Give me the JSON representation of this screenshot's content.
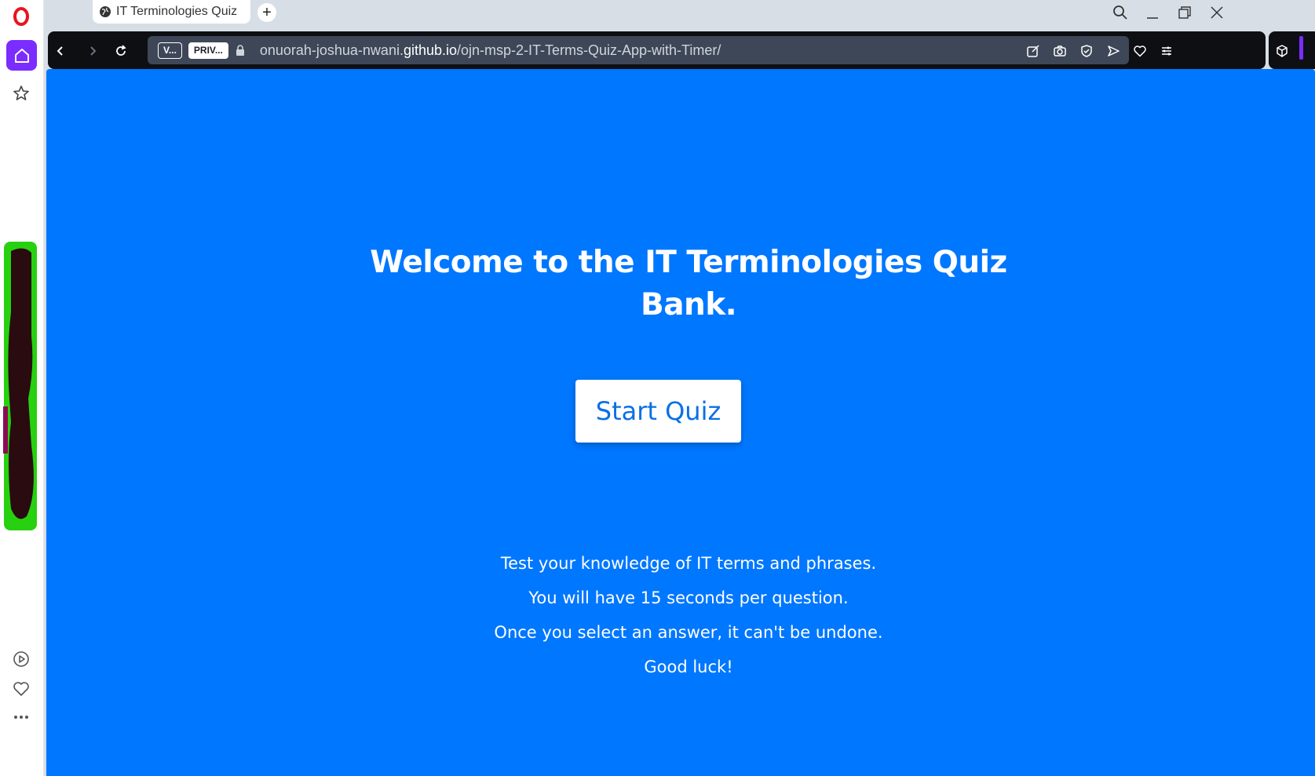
{
  "browser": {
    "tab_title": "IT Terminologies Quiz",
    "new_tab_symbol": "+",
    "address_chips": [
      "V...",
      "PRIV..."
    ],
    "url_prefix": "onuorah-joshua-nwani.",
    "url_domain": "github.io",
    "url_path": "/ojn-msp-2-IT-Terms-Quiz-App-with-Timer/"
  },
  "sidebar": {
    "icons": [
      "opera-logo-icon",
      "home-icon",
      "star-icon",
      "play-icon",
      "heart-icon",
      "more-icon"
    ]
  },
  "page": {
    "heading_line1": "Welcome to the IT Terminologies Quiz",
    "heading_line2": "Bank.",
    "start_button": "Start Quiz",
    "intro": [
      "Test your knowledge of IT terms and phrases.",
      "You will have 15 seconds per question.",
      "Once you select an answer, it can't be undone.",
      "Good luck!"
    ]
  },
  "colors": {
    "page_background": "#0077ff",
    "button_text": "#0a6fe6",
    "sidebar_accent": "#7b2cff"
  }
}
